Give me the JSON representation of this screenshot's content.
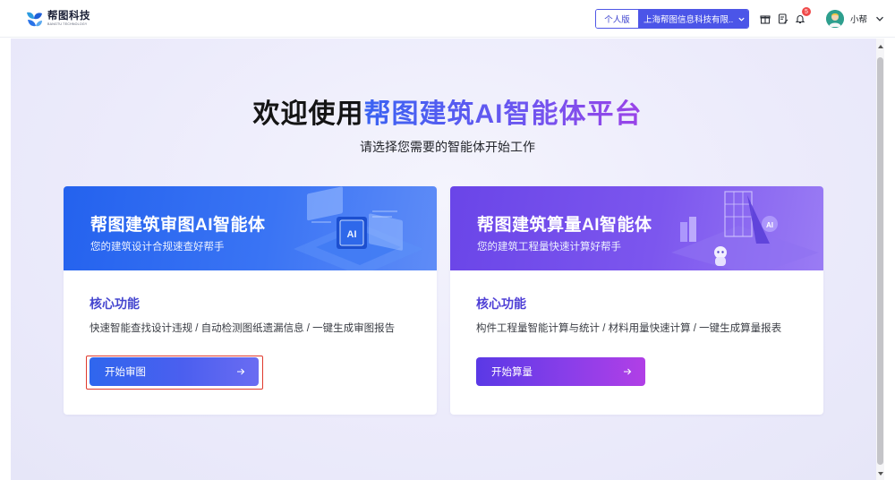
{
  "header": {
    "logo": {
      "title": "帮图科技",
      "subtitle": "BANGTU TECHNOLOGY"
    },
    "org_switch": {
      "mode_label": "个人版",
      "selected_org": "上海帮图信息科技有限..."
    },
    "icons": [
      "gift-icon",
      "document-edit-icon",
      "bell-icon"
    ],
    "notification_count": "5",
    "user": {
      "name": "小帮"
    }
  },
  "hero": {
    "title_plain": "欢迎使用",
    "title_highlight": "帮图建筑AI智能体平台",
    "subtitle": "请选择您需要的智能体开始工作"
  },
  "cards": [
    {
      "title": "帮图建筑审图AI智能体",
      "subtitle": "您的建筑设计合规速查好帮手",
      "core_title": "核心功能",
      "core_desc": "快速智能查找设计违规 / 自动检测图纸遗漏信息 / 一键生成审图报告",
      "button_label": "开始审图",
      "illustration_badge": "AI"
    },
    {
      "title": "帮图建筑算量AI智能体",
      "subtitle": "您的建筑工程量快速计算好帮手",
      "core_title": "核心功能",
      "core_desc": "构件工程量智能计算与统计 / 材料用量快速计算 / 一键生成算量报表",
      "button_label": "开始算量",
      "illustration_badge": "AI"
    }
  ],
  "colors": {
    "brand_blue": "#2f66ee",
    "brand_purple": "#7c56ee",
    "notification_red": "#f04a4a",
    "focus_outline": "#e0392d"
  }
}
